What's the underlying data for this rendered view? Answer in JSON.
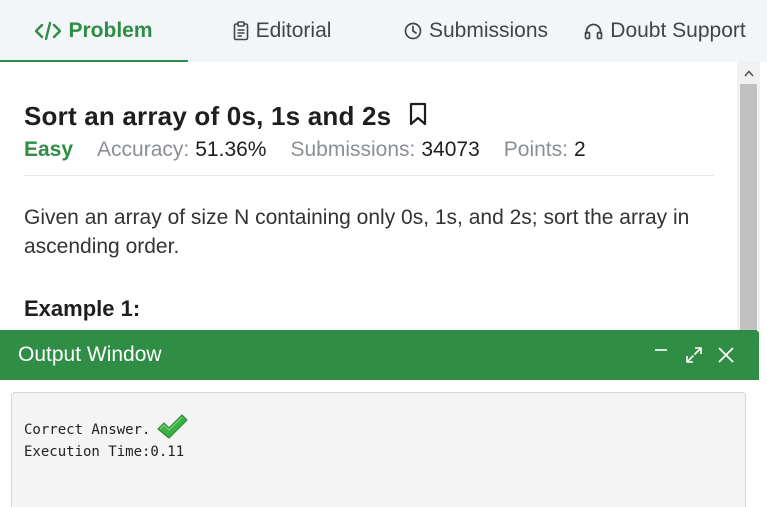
{
  "tabs": [
    {
      "label": "Problem",
      "icon": "code-icon",
      "active": true
    },
    {
      "label": "Editorial",
      "icon": "clipboard-icon",
      "active": false
    },
    {
      "label": "Submissions",
      "icon": "clock-icon",
      "active": false
    },
    {
      "label": "Doubt Support",
      "icon": "headset-icon",
      "active": false
    }
  ],
  "problem": {
    "title": "Sort an array of 0s, 1s and 2s",
    "difficulty": "Easy",
    "accuracy_label": "Accuracy:",
    "accuracy_value": "51.36%",
    "submissions_label": "Submissions:",
    "submissions_value": "34073",
    "points_label": "Points:",
    "points_value": "2",
    "description": "Given an array of size N containing only 0s, 1s, and 2s; sort the array in ascending order.",
    "example_heading": "Example 1:"
  },
  "output": {
    "title": "Output Window",
    "result": "Correct Answer.",
    "time": "Execution Time:0.11"
  },
  "colors": {
    "accent": "#2f8d46",
    "muted": "#8a8f96",
    "check": "#3cb043"
  }
}
